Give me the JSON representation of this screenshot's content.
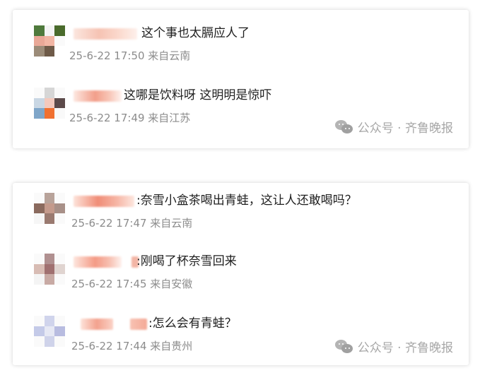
{
  "cards": [
    {
      "comments": [
        {
          "text": "这个事也太膈应人了",
          "meta": "25-6-22 17:50 来自云南"
        },
        {
          "text": "这哪是饮料呀 这明明是惊吓",
          "meta": "25-6-22 17:49 来自江苏"
        }
      ],
      "watermark": "公众号 · 齐鲁晚报"
    },
    {
      "comments": [
        {
          "text": ":奈雪小盒茶喝出青蛙，这让人还敢喝吗？",
          "meta": "25-6-22 17:47 来自云南"
        },
        {
          "text": ":刚喝了杯奈雪回来",
          "meta": "25-6-22 17:45 来自安徽"
        },
        {
          "text": ":怎么会有青蛙？",
          "meta": "25-6-22 17:44 来自贵州"
        }
      ],
      "watermark": "公众号 · 齐鲁晚报"
    }
  ],
  "icons": {
    "watermark": "wechat-icon"
  },
  "colors": {
    "text": "#1e1e1e",
    "meta": "#8c8c8c",
    "watermark": "#a7a7a7",
    "username_blur": "#f7c4b6"
  }
}
